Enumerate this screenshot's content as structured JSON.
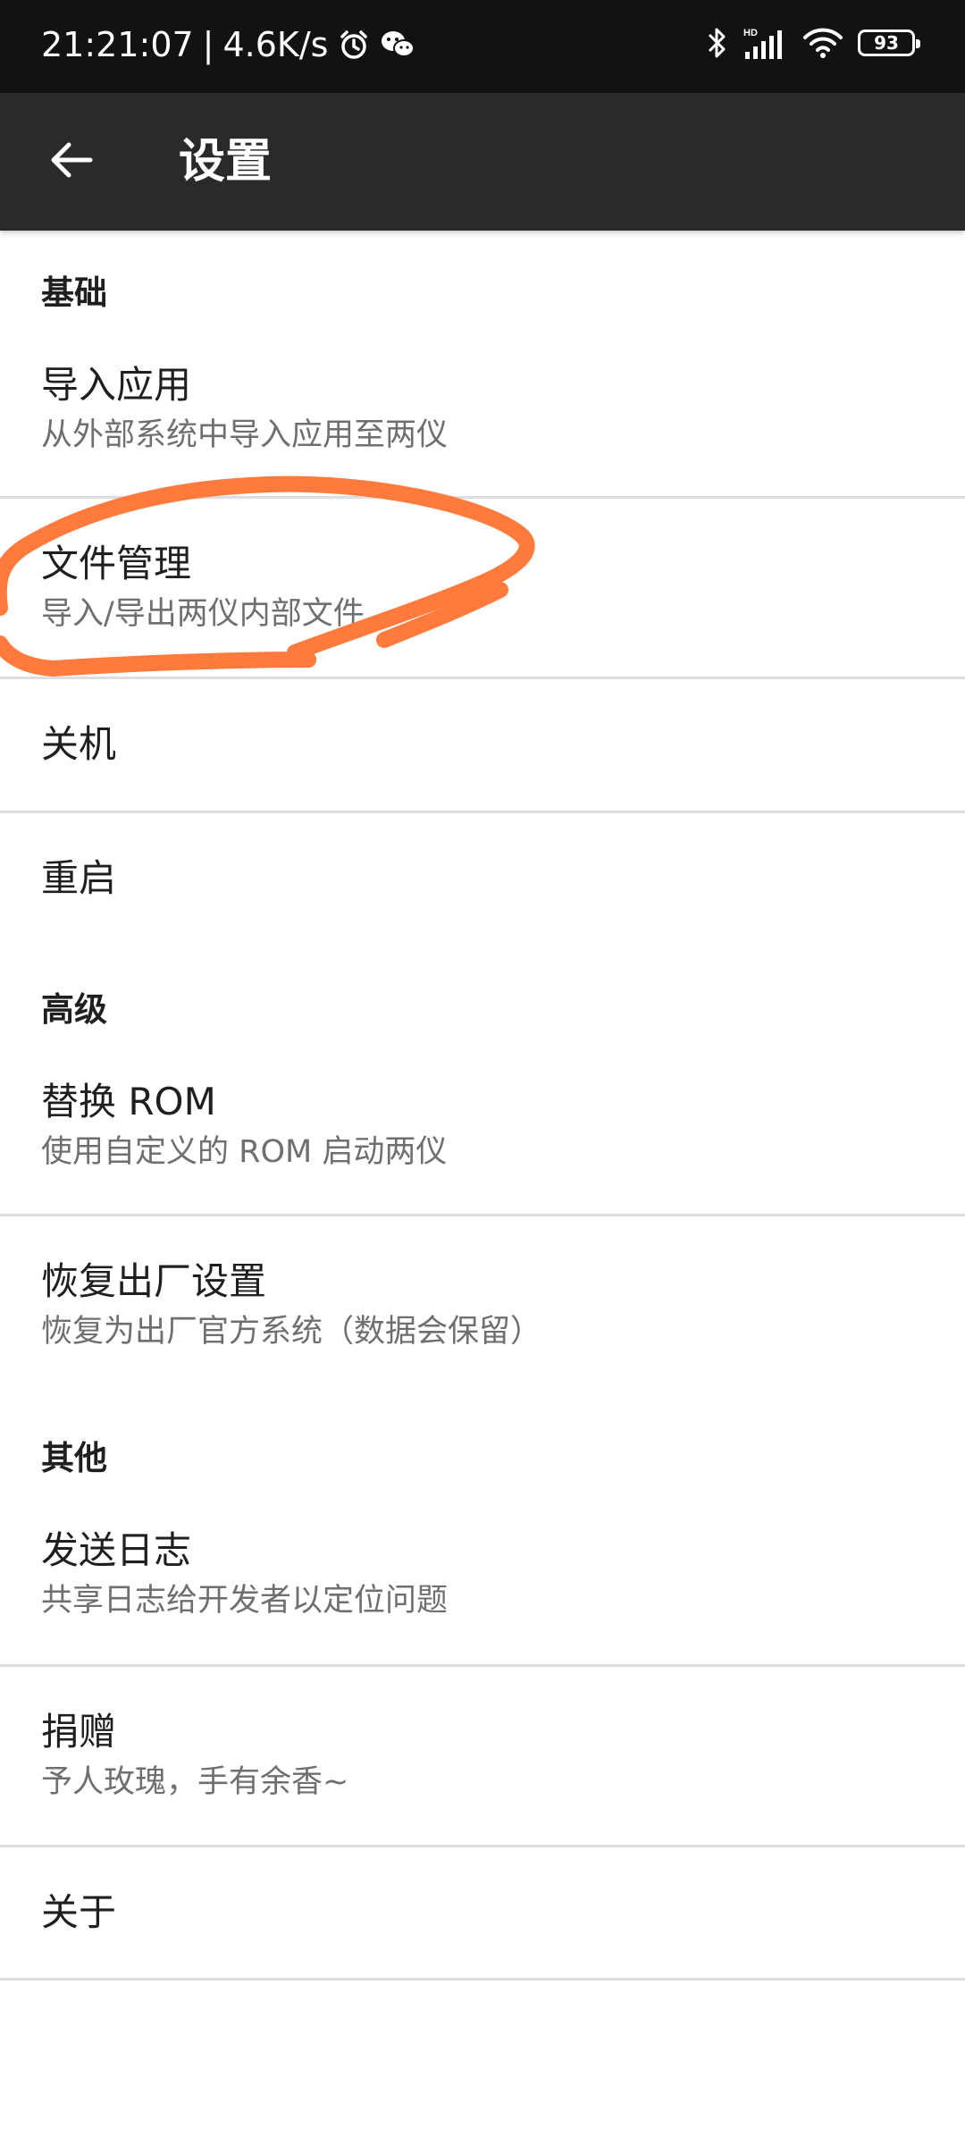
{
  "status_bar": {
    "time": "21:21:07",
    "separator": "|",
    "speed": "4.6K/s",
    "battery": "93",
    "icons": [
      "alarm-icon",
      "wechat-icon",
      "bluetooth-icon",
      "hd-signal-icon",
      "wifi-icon",
      "battery-icon"
    ]
  },
  "toolbar": {
    "back_icon": "arrow-left-icon",
    "title": "设置"
  },
  "sections": {
    "basic": {
      "header": "基础",
      "import_app": {
        "title": "导入应用",
        "subtitle": "从外部系统中导入应用至两仪"
      },
      "file_manage": {
        "title": "文件管理",
        "subtitle": "导入/导出两仪内部文件"
      },
      "shutdown": {
        "title": "关机"
      },
      "restart": {
        "title": "重启"
      }
    },
    "advanced": {
      "header": "高级",
      "replace_rom": {
        "title": "替换 ROM",
        "subtitle": "使用自定义的 ROM 启动两仪"
      },
      "factory_reset": {
        "title": "恢复出厂设置",
        "subtitle": "恢复为出厂官方系统（数据会保留）"
      }
    },
    "other": {
      "header": "其他",
      "send_log": {
        "title": "发送日志",
        "subtitle": "共享日志给开发者以定位问题"
      },
      "donate": {
        "title": "捐赠",
        "subtitle": "予人玫瑰，手有余香~"
      },
      "about": {
        "title": "关于"
      }
    }
  },
  "annotation": {
    "color": "#ff7a3d",
    "shape": "hand-drawn-circle",
    "target": "文件管理"
  },
  "colors": {
    "status_bar_bg": "#121212",
    "toolbar_bg": "#2a2a2a",
    "title_text": "#1f1f1f",
    "subtitle_text": "#6f6f6f",
    "divider": "#dedede"
  }
}
